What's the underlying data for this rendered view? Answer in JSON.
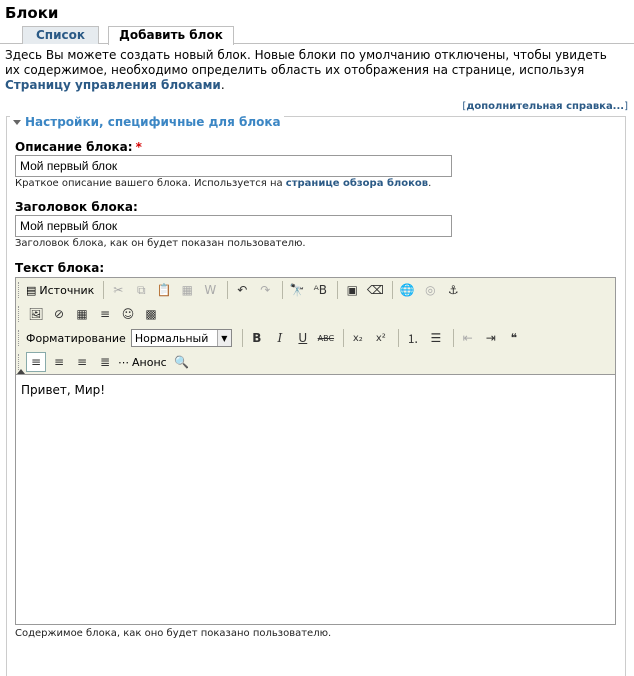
{
  "page_title": "Блоки",
  "tabs": [
    {
      "label": "Список"
    },
    {
      "label": "Добавить блок"
    }
  ],
  "intro": {
    "text": "Здесь Вы можете создать новый блок. Новые блоки по умолчанию отключены, чтобы увидеть их содержимое, необходимо определить область их отображения на странице, используя ",
    "link": "Страницу управления блоками",
    "end": "."
  },
  "help": {
    "open": "[",
    "link": "дополнительная справка...",
    "close": "]"
  },
  "fieldset": {
    "legend": "Настройки, специфичные для блока"
  },
  "description_field": {
    "label": "Описание блока:",
    "required": "*",
    "value": "Мой первый блок",
    "help_text": "Краткое описание вашего блока. Используется на ",
    "help_link": "странице обзора блоков",
    "help_end": "."
  },
  "title_field": {
    "label": "Заголовок блока:",
    "value": "Мой первый блок",
    "help_text": "Заголовок блока, как он будет показан пользователю."
  },
  "body_field": {
    "label": "Текст блока:",
    "content": "Привет, Мир!",
    "help_text": "Содержимое блока, как оно будет показано пользователю."
  },
  "toolbar": {
    "source_label": "Источник",
    "format_label": "Форматирование",
    "format_value": "Нормальный",
    "teaser_label": "Анонс"
  }
}
